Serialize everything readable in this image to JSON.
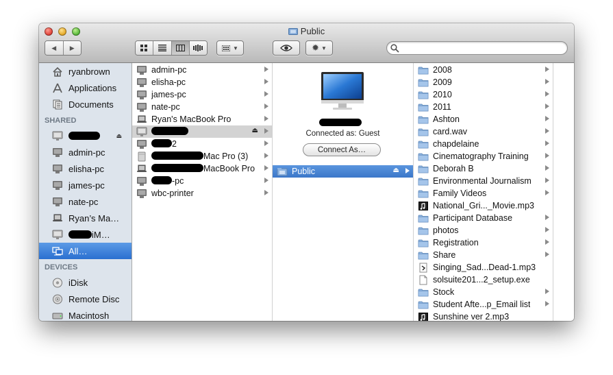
{
  "window": {
    "title": "Public"
  },
  "toolbar": {
    "back": "◀",
    "forward": "▶",
    "views": [
      "icon-view-icon",
      "list-view-icon",
      "column-view-icon",
      "coverflow-view-icon"
    ],
    "search_placeholder": ""
  },
  "sidebar": {
    "favorites": [
      {
        "label": "ryanbrown",
        "icon": "home-icon"
      },
      {
        "label": "Applications",
        "icon": "applications-icon"
      },
      {
        "label": "Documents",
        "icon": "documents-icon"
      }
    ],
    "shared_header": "SHARED",
    "shared": [
      {
        "label": "",
        "icon": "imac-icon",
        "redacted": true,
        "eject": true
      },
      {
        "label": "admin-pc",
        "icon": "pc-icon"
      },
      {
        "label": "elisha-pc",
        "icon": "pc-icon"
      },
      {
        "label": "james-pc",
        "icon": "pc-icon"
      },
      {
        "label": "nate-pc",
        "icon": "pc-icon"
      },
      {
        "label": "Ryan’s Ma…",
        "icon": "laptop-icon"
      },
      {
        "label": "iM…",
        "icon": "imac-icon",
        "redacted": true
      },
      {
        "label": "All…",
        "icon": "network-icon",
        "selected": true
      }
    ],
    "devices_header": "DEVICES",
    "devices": [
      {
        "label": "iDisk",
        "icon": "idisk-icon"
      },
      {
        "label": "Remote Disc",
        "icon": "disc-icon"
      },
      {
        "label": "Macintosh",
        "icon": "hd-icon"
      }
    ]
  },
  "column1": [
    {
      "label": "admin-pc",
      "icon": "pc-icon"
    },
    {
      "label": "elisha-pc",
      "icon": "pc-icon"
    },
    {
      "label": "james-pc",
      "icon": "pc-icon"
    },
    {
      "label": "nate-pc",
      "icon": "pc-icon"
    },
    {
      "label": "Ryan's MacBook Pro",
      "icon": "laptop-icon"
    },
    {
      "label": "",
      "icon": "imac-icon",
      "redacted": true,
      "eject": true,
      "selected": true
    },
    {
      "label": "2",
      "icon": "pc-icon",
      "redacted": true
    },
    {
      "label": "Mac Pro (3)",
      "icon": "macpro-icon",
      "redacted": true
    },
    {
      "label": "MacBook Pro",
      "icon": "laptop-icon",
      "redacted": true
    },
    {
      "label": "-pc",
      "icon": "pc-icon",
      "redacted": true
    },
    {
      "label": "wbc-printer",
      "icon": "pc-icon"
    }
  ],
  "column2": {
    "connected_as": "Connected as: Guest",
    "connect_as_button": "Connect As…",
    "items": [
      {
        "label": "Public",
        "icon": "shared-folder-icon",
        "eject": true,
        "selected": true
      }
    ]
  },
  "column3": [
    {
      "label": "2008",
      "type": "folder"
    },
    {
      "label": "2009",
      "type": "folder"
    },
    {
      "label": "2010",
      "type": "folder"
    },
    {
      "label": "2011",
      "type": "folder"
    },
    {
      "label": "Ashton",
      "type": "folder"
    },
    {
      "label": "card.wav",
      "type": "folder"
    },
    {
      "label": "chapdelaine",
      "type": "folder"
    },
    {
      "label": "Cinematography Training",
      "type": "folder"
    },
    {
      "label": "Deborah B",
      "type": "folder"
    },
    {
      "label": "Environmental Journalism",
      "type": "folder"
    },
    {
      "label": "Family Videos",
      "type": "folder"
    },
    {
      "label": "National_Gri..._Movie.mp3",
      "type": "audio"
    },
    {
      "label": "Participant Database",
      "type": "folder"
    },
    {
      "label": "photos",
      "type": "folder"
    },
    {
      "label": "Registration",
      "type": "folder"
    },
    {
      "label": "Share",
      "type": "folder"
    },
    {
      "label": "Singing_Sad...Dead-1.mp3",
      "type": "script"
    },
    {
      "label": "solsuite201...2_setup.exe",
      "type": "doc"
    },
    {
      "label": "Stock",
      "type": "folder"
    },
    {
      "label": "Student Afte...p_Email list",
      "type": "folder"
    },
    {
      "label": "Sunshine ver 2.mp3",
      "type": "audio"
    }
  ]
}
